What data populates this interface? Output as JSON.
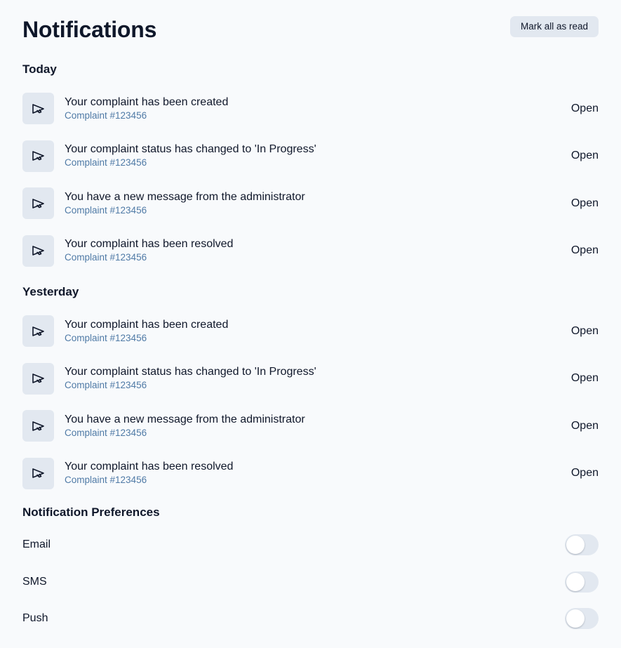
{
  "header": {
    "title": "Notifications",
    "mark_all_label": "Mark all as read"
  },
  "sections": {
    "today": {
      "title": "Today",
      "items": [
        {
          "icon": "megaphone-icon",
          "title": "Your complaint has been created",
          "sub": "Complaint #123456",
          "action": "Open"
        },
        {
          "icon": "megaphone-icon",
          "title": "Your complaint status has changed to 'In Progress'",
          "sub": "Complaint #123456",
          "action": "Open"
        },
        {
          "icon": "megaphone-icon",
          "title": "You have a new message from the administrator",
          "sub": "Complaint #123456",
          "action": "Open"
        },
        {
          "icon": "megaphone-icon",
          "title": "Your complaint has been resolved",
          "sub": "Complaint #123456",
          "action": "Open"
        }
      ]
    },
    "yesterday": {
      "title": "Yesterday",
      "items": [
        {
          "icon": "megaphone-icon",
          "title": "Your complaint has been created",
          "sub": "Complaint #123456",
          "action": "Open"
        },
        {
          "icon": "megaphone-icon",
          "title": "Your complaint status has changed to 'In Progress'",
          "sub": "Complaint #123456",
          "action": "Open"
        },
        {
          "icon": "megaphone-icon",
          "title": "You have a new message from the administrator",
          "sub": "Complaint #123456",
          "action": "Open"
        },
        {
          "icon": "megaphone-icon",
          "title": "Your complaint has been resolved",
          "sub": "Complaint #123456",
          "action": "Open"
        }
      ]
    }
  },
  "preferences": {
    "title": "Notification Preferences",
    "items": [
      {
        "label": "Email",
        "enabled": false
      },
      {
        "label": "SMS",
        "enabled": false
      },
      {
        "label": "Push",
        "enabled": false
      }
    ]
  },
  "colors": {
    "background": "#f8fafc",
    "icon_bg": "#e2e8f0",
    "subtext": "#4f7aa6",
    "text": "#0f172a"
  }
}
